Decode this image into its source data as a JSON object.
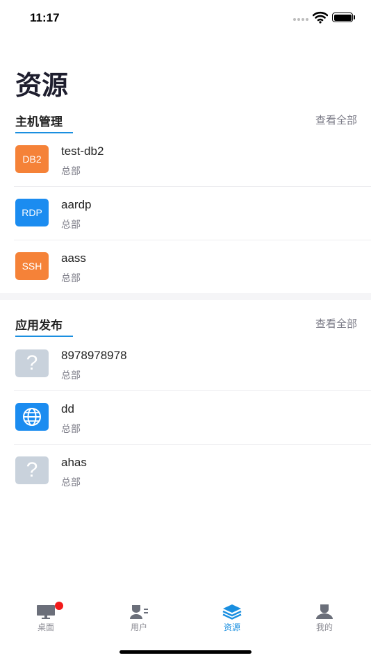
{
  "status_bar": {
    "time": "11:17"
  },
  "page": {
    "title": "资源"
  },
  "hosts_section": {
    "title": "主机管理",
    "view_all": "查看全部",
    "items": [
      {
        "badge": "DB2",
        "color": "#f58238",
        "name": "test-db2",
        "sub": "总部"
      },
      {
        "badge": "RDP",
        "color": "#1b8cf0",
        "name": "aardp",
        "sub": "总部"
      },
      {
        "badge": "SSH",
        "color": "#f58238",
        "name": "aass",
        "sub": "总部"
      }
    ]
  },
  "apps_section": {
    "title": "应用发布",
    "view_all": "查看全部",
    "items": [
      {
        "icon": "question-icon",
        "glyph": "?",
        "name": "8978978978",
        "sub": "总部"
      },
      {
        "icon": "globe-icon",
        "name": "dd",
        "sub": "总部"
      },
      {
        "icon": "question-icon",
        "glyph": "?",
        "name": "ahas",
        "sub": "总部"
      }
    ]
  },
  "tab_bar": {
    "tabs": [
      {
        "label": "桌面",
        "icon": "monitor-icon",
        "active": false,
        "has_badge": true
      },
      {
        "label": "用户",
        "icon": "user-list-icon",
        "active": false
      },
      {
        "label": "资源",
        "icon": "layers-icon",
        "active": true
      },
      {
        "label": "我的",
        "icon": "person-icon",
        "active": false
      }
    ]
  },
  "colors": {
    "accent": "#1a8fe0",
    "orange": "#f58238",
    "blue": "#1b8cf0",
    "badge_red": "#f21a1a"
  }
}
